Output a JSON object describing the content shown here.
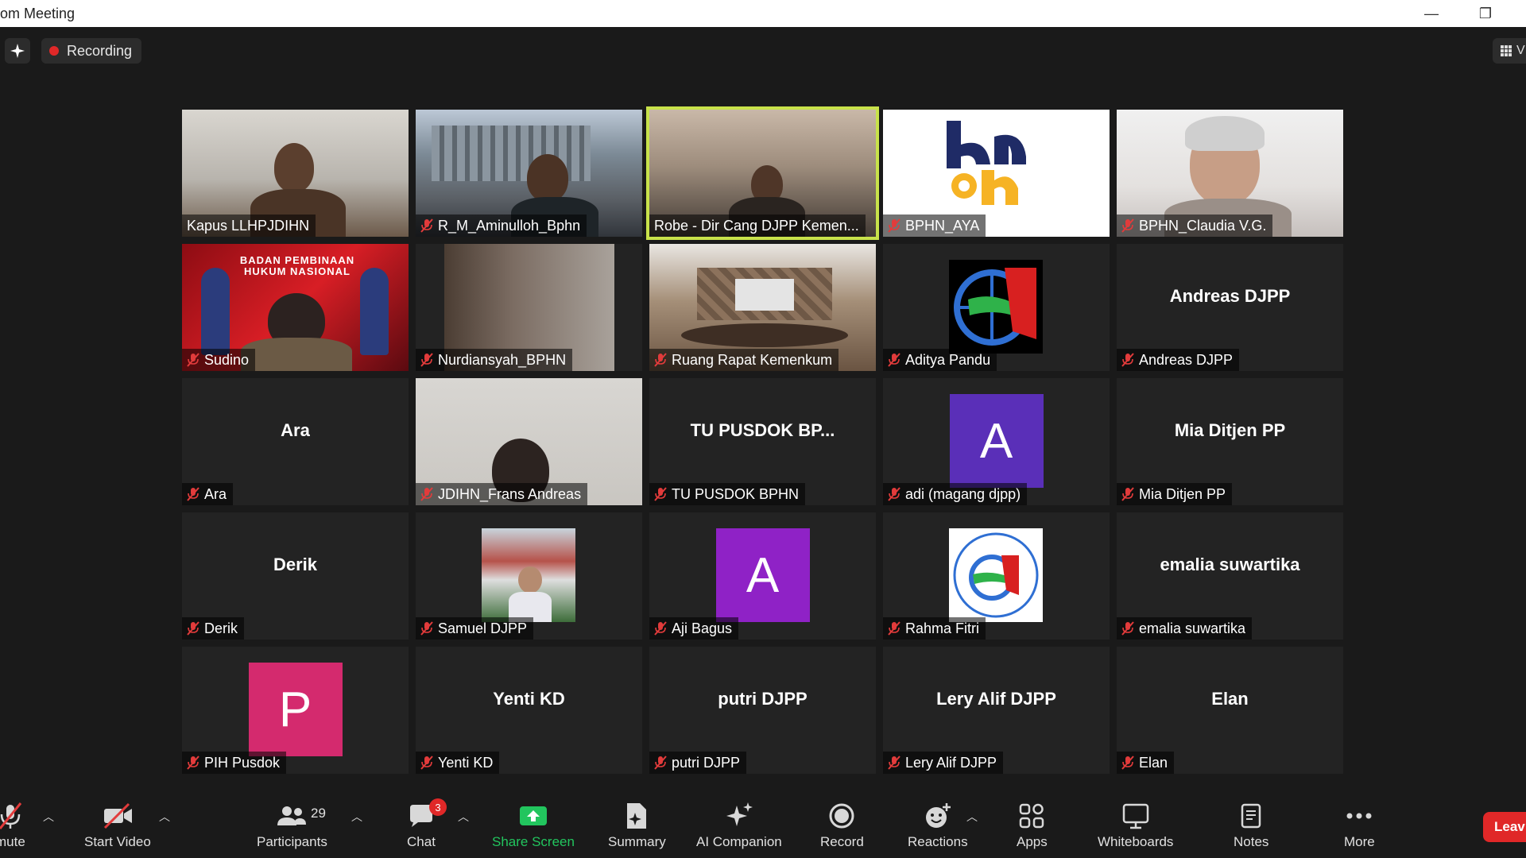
{
  "window": {
    "title": "om Meeting",
    "minimize_glyph": "—",
    "restore_glyph": "❐"
  },
  "topbar": {
    "recording_label": "Recording",
    "view_label": "V"
  },
  "gallery": {
    "tiles": [
      {
        "name": "Kapus LLHPJDIHN",
        "muted": false,
        "display": "video"
      },
      {
        "name": "R_M_Aminulloh_Bphn",
        "muted": true,
        "display": "video"
      },
      {
        "name": "Robe - Dir Cang DJPP Kemen...",
        "muted": false,
        "display": "video",
        "active_speaker": true
      },
      {
        "name": "BPHN_AYA",
        "muted": true,
        "display": "logo"
      },
      {
        "name": "BPHN_Claudia V.G.",
        "muted": true,
        "display": "video"
      },
      {
        "name": "Sudino",
        "muted": true,
        "display": "video",
        "banner_text": "BADAN PEMBINAAN HUKUM NASIONAL"
      },
      {
        "name": "Nurdiansyah_BPHN",
        "muted": true,
        "display": "video"
      },
      {
        "name": "Ruang Rapat Kemenkum",
        "muted": true,
        "display": "video"
      },
      {
        "name": "Aditya Pandu",
        "muted": true,
        "display": "profile-picture"
      },
      {
        "name": "Andreas DJPP",
        "muted": true,
        "display": "name",
        "big_name": "Andreas DJPP"
      },
      {
        "name": "Ara",
        "muted": true,
        "display": "name",
        "big_name": "Ara"
      },
      {
        "name": "JDIHN_Frans Andreas",
        "muted": true,
        "display": "video"
      },
      {
        "name": "TU PUSDOK BPHN",
        "muted": true,
        "display": "name",
        "big_name": "TU PUSDOK BP..."
      },
      {
        "name": "adi (magang djpp)",
        "muted": true,
        "display": "avatar",
        "avatar_letter": "A",
        "avatar_color": "#5a2fb8"
      },
      {
        "name": "Mia Ditjen PP",
        "muted": true,
        "display": "name",
        "big_name": "Mia Ditjen PP"
      },
      {
        "name": "Derik",
        "muted": true,
        "display": "name",
        "big_name": "Derik"
      },
      {
        "name": "Samuel DJPP",
        "muted": true,
        "display": "profile-picture"
      },
      {
        "name": "Aji Bagus",
        "muted": true,
        "display": "avatar",
        "avatar_letter": "A",
        "avatar_color": "#8f22c6"
      },
      {
        "name": "Rahma Fitri",
        "muted": true,
        "display": "profile-picture"
      },
      {
        "name": "emalia suwartika",
        "muted": true,
        "display": "name",
        "big_name": "emalia suwartika"
      },
      {
        "name": "PIH Pusdok",
        "muted": true,
        "display": "avatar",
        "avatar_letter": "P",
        "avatar_color": "#d42a6e"
      },
      {
        "name": "Yenti KD",
        "muted": true,
        "display": "name",
        "big_name": "Yenti KD"
      },
      {
        "name": "putri DJPP",
        "muted": true,
        "display": "name",
        "big_name": "putri DJPP"
      },
      {
        "name": "Lery Alif DJPP",
        "muted": true,
        "display": "name",
        "big_name": "Lery Alif DJPP"
      },
      {
        "name": "Elan",
        "muted": true,
        "display": "name",
        "big_name": "Elan"
      }
    ]
  },
  "toolbar": {
    "unmute_label": "mute",
    "start_video_label": "Start Video",
    "participants_label": "Participants",
    "participants_count": "29",
    "chat_label": "Chat",
    "chat_badge": "3",
    "share_screen_label": "Share Screen",
    "summary_label": "Summary",
    "ai_companion_label": "AI Companion",
    "record_label": "Record",
    "reactions_label": "Reactions",
    "apps_label": "Apps",
    "whiteboards_label": "Whiteboards",
    "notes_label": "Notes",
    "more_label": "More",
    "leave_label": "Leav"
  },
  "colors": {
    "background": "#1a1a1a",
    "tile": "#232323",
    "active_speaker_border": "#c8e24a",
    "share_screen": "#22c55e",
    "leave": "#e02828",
    "recording_dot": "#e02828"
  }
}
